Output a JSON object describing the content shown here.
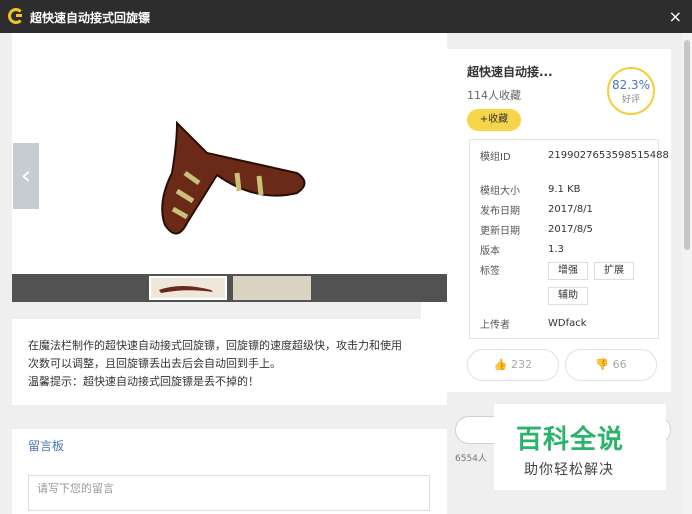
{
  "window": {
    "title": "超快速自动接式回旋镖",
    "close_glyph": "×"
  },
  "gallery": {
    "prev_glyph": "‹",
    "next_glyph": "›",
    "thumbnails": [
      "boomerang",
      "screenshot"
    ]
  },
  "description": {
    "line1": "在魔法栏制作的超快速自动接式回旋镖，回旋镖的速度超级快，攻击力和使用",
    "line2": "次数可以调整，且回旋镖丢出去后会自动回到手上。",
    "line3": "温馨提示：超快速自动接式回旋镖是丢不掉的！"
  },
  "board": {
    "title": "留言板",
    "placeholder": "请写下您的留言"
  },
  "side": {
    "name": "超快速自动接...",
    "favorites": "114人收藏",
    "rating_pct": "82.3%",
    "rating_label": "好评",
    "fav_button": "+收藏",
    "info": [
      {
        "label": "模组ID",
        "value": "2199027653598515488"
      },
      {
        "label": "模组大小",
        "value": "9.1 KB"
      },
      {
        "label": "发布日期",
        "value": "2017/8/1"
      },
      {
        "label": "更新日期",
        "value": "2017/8/5"
      },
      {
        "label": "版本",
        "value": "1.3"
      },
      {
        "label": "标签",
        "value": ""
      },
      {
        "label": "上传者",
        "value": "WDfack"
      }
    ],
    "tags": [
      "增强",
      "扩展",
      "辅助"
    ],
    "up_votes": "232",
    "down_votes": "66"
  },
  "download": {
    "count_text": "6554人"
  },
  "watermark": {
    "line1": "百科全说",
    "line2": "助你轻松解决"
  },
  "colors": {
    "accent": "#f6d54b",
    "title_bg": "#2d2d2d",
    "link": "#4a76b5"
  }
}
